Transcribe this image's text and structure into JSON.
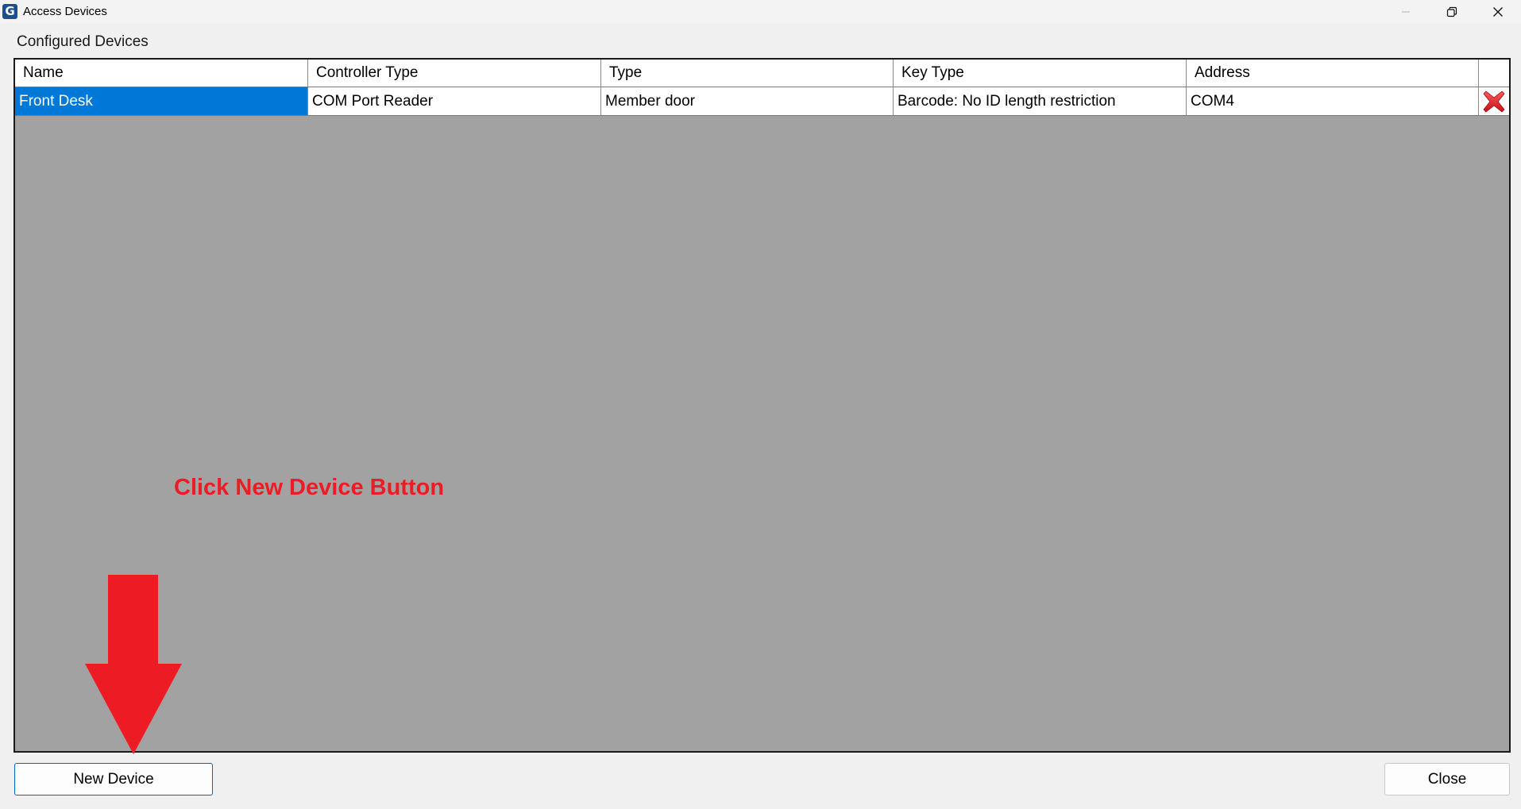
{
  "window": {
    "title": "Access Devices",
    "app_icon_letter": "G",
    "controls": {
      "minimize_icon": "minimize-icon",
      "restore_icon": "restore-icon",
      "close_icon": "close-icon"
    }
  },
  "section_label": "Configured Devices",
  "grid": {
    "columns": [
      "Name",
      "Controller Type",
      "Type",
      "Key Type",
      "Address",
      ""
    ],
    "rows": [
      {
        "name": "Front Desk",
        "controller_type": "COM Port Reader",
        "type": "Member door",
        "key_type": "Barcode: No ID length restriction",
        "address": "COM4",
        "delete_icon": "delete-x-icon",
        "selected": true
      }
    ]
  },
  "annotation": {
    "text": "Click New Device Button",
    "color": "#ed1c24"
  },
  "buttons": {
    "new_device": "New Device",
    "close": "Close"
  },
  "colors": {
    "selection": "#0078d7",
    "grid_background": "#a2a2a2",
    "delete_icon": "#e0262b"
  }
}
